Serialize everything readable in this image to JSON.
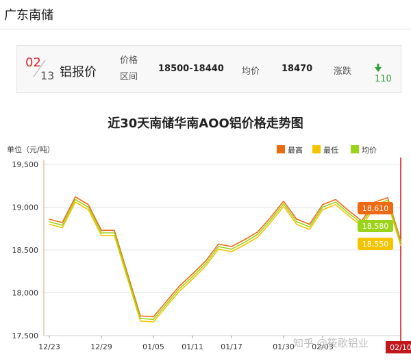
{
  "page": {
    "title": "广东南储"
  },
  "quote": {
    "month": "02",
    "day": "13",
    "product": "铝报价",
    "range_label_1": "价格",
    "range_label_2": "区间",
    "range_value": "18500-18440",
    "avg_label": "均价",
    "avg_value": "18470",
    "change_label": "涨跌",
    "change_value": "110",
    "change_color": "#2e9e3a"
  },
  "chart_data": {
    "type": "line",
    "title": "近30天南储华南AOO铝价格走势图",
    "unit_label": "单位（元/吨）",
    "ylim": [
      17500,
      19500
    ],
    "yticks": [
      17500,
      18000,
      18500,
      19000,
      19500
    ],
    "ytick_labels": [
      "17,500",
      "18,000",
      "18,500",
      "19,000",
      "19,500"
    ],
    "xtick_labels": [
      "12/23",
      "12/29",
      "01/05",
      "01/11",
      "01/17",
      "01/30",
      "02/03",
      "02/10"
    ],
    "xtick_index": [
      0,
      4,
      8,
      11,
      14,
      18,
      21,
      27
    ],
    "series": [
      {
        "name": "最高",
        "color": "#ee6a12",
        "values": [
          18860,
          18820,
          19120,
          19030,
          18730,
          18730,
          18230,
          17730,
          17720,
          17900,
          18080,
          18220,
          18370,
          18570,
          18540,
          18620,
          18710,
          18880,
          19070,
          18860,
          18800,
          19030,
          19090,
          18960,
          18840,
          19060,
          19110,
          18610
        ]
      },
      {
        "name": "最低",
        "color": "#f4c400",
        "values": [
          18800,
          18760,
          19060,
          18970,
          18670,
          18670,
          18170,
          17670,
          17660,
          17840,
          18020,
          18160,
          18310,
          18510,
          18480,
          18560,
          18650,
          18820,
          19010,
          18800,
          18740,
          18970,
          19030,
          18900,
          18780,
          19000,
          19050,
          18550
        ]
      },
      {
        "name": "均价",
        "color": "#9bd31a",
        "values": [
          18830,
          18790,
          19090,
          19000,
          18700,
          18700,
          18200,
          17700,
          17690,
          17870,
          18050,
          18190,
          18340,
          18540,
          18510,
          18590,
          18680,
          18850,
          19040,
          18830,
          18770,
          19000,
          19060,
          18930,
          18810,
          19030,
          19080,
          18580
        ]
      }
    ],
    "end_labels": [
      {
        "text": "18,610",
        "color": "#ee6a12"
      },
      {
        "text": "18,580",
        "color": "#9bd31a"
      },
      {
        "text": "18,550",
        "color": "#f4c400"
      }
    ],
    "last_date_badge": "02/10",
    "watermark": "知乎 @筱歌铝业",
    "legend_position": "top-right",
    "grid": "horizontal"
  }
}
